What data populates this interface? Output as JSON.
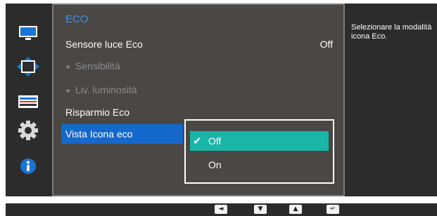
{
  "side_nav": {
    "icons": [
      "monitor-icon",
      "screen-size-arrows-icon",
      "color-bars-icon",
      "gear-icon",
      "info-icon"
    ],
    "colors": {
      "blue": "#1a74d6",
      "active_bg": "#2c2c2c"
    }
  },
  "menu": {
    "title": "ECO",
    "items": [
      {
        "label": "Sensore luce Eco",
        "value": "Off"
      },
      {
        "label": "Sensibilità",
        "disabled": true
      },
      {
        "label": "Liv. luminosità",
        "disabled": true
      },
      {
        "label": "Risparmio Eco"
      },
      {
        "label": "Vista Icona eco",
        "selected": true
      }
    ],
    "colors": {
      "title": "#3f8ff0",
      "selection": "#1568cc",
      "panel": "#4a4745"
    }
  },
  "dropdown": {
    "options": [
      {
        "label": "Off",
        "selected": true,
        "mark": "✔"
      },
      {
        "label": "On"
      }
    ],
    "colors": {
      "selected": "#17b6a8"
    }
  },
  "help": {
    "text": "Selezionare la modalità icona Eco."
  },
  "bottom_bar": {
    "keys": [
      {
        "icon": "left-arrow-key-icon",
        "glyph": "◄"
      },
      {
        "icon": "down-arrow-key-icon",
        "glyph": "▼"
      },
      {
        "icon": "up-arrow-key-icon",
        "glyph": "▲"
      },
      {
        "icon": "enter-key-icon",
        "glyph": "↵"
      }
    ]
  }
}
